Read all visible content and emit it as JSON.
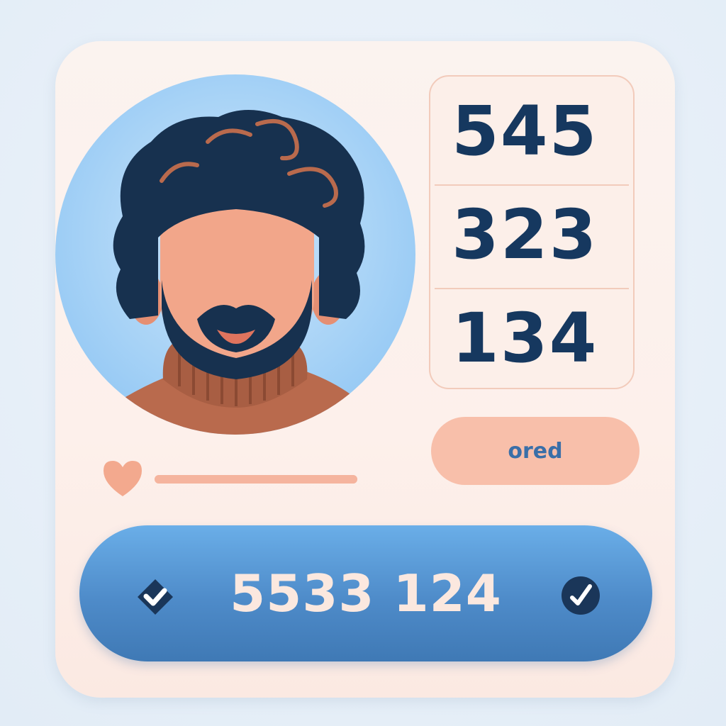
{
  "profile": {
    "avatar_icon": "bearded-man-avatar"
  },
  "scores": {
    "values": [
      "545",
      "323",
      "134"
    ]
  },
  "status": {
    "label": "ored"
  },
  "favorite": {
    "icon": "heart-icon",
    "progress": 1.0
  },
  "action": {
    "label": "5533 124",
    "left_icon": "check-badge-icon",
    "right_icon": "check-icon"
  },
  "colors": {
    "accent_blue": "#4e8bc9",
    "text_navy": "#16385f",
    "peach": "#f8bfaa",
    "card_bg": "#fbf3ef"
  }
}
